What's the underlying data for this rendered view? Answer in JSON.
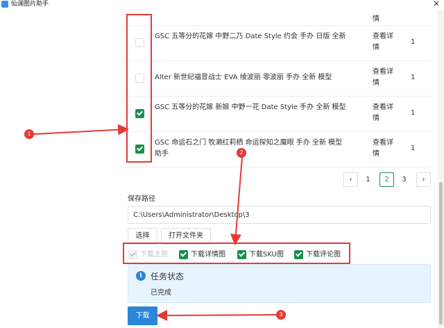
{
  "window": {
    "title": "仙澜图片助手",
    "minimize": "—",
    "maximize": "☐",
    "close": "✕"
  },
  "table": {
    "partial_top_detail": "情",
    "rows": [
      {
        "name": "GSC 五等分的花嫁 中野二乃 Date Style 约会 手办 日版 全新",
        "detail": "查看详情",
        "qty": "1",
        "checked": false
      },
      {
        "name": "Alter 新世纪福音战士 EVA 绫波丽 零波丽 手办 全新 模型",
        "detail": "查看详情",
        "qty": "1",
        "checked": false
      },
      {
        "name": "GSC 五等分的花嫁 新娘 中野一花 Date Style 手办 全新 模型",
        "detail": "查看详情",
        "qty": "1",
        "checked": true
      },
      {
        "name": "GSC 命运石之门 牧濑红莉栖 命运探知之魔眼 手办 全新 模型 助手",
        "detail": "查看详情",
        "qty": "1",
        "checked": true
      }
    ]
  },
  "pagination": {
    "prev": "‹",
    "pages": [
      "1",
      "2",
      "3"
    ],
    "active_page": "2",
    "next": "›"
  },
  "save": {
    "label": "保存路径",
    "path_value": "C:\\Users\\Administrator\\Desktop\\3",
    "choose_button": "选择",
    "open_folder_button": "打开文件夹"
  },
  "options": [
    {
      "label": "下载主图",
      "checked": true,
      "disabled": true
    },
    {
      "label": "下载详情图",
      "checked": true,
      "disabled": false
    },
    {
      "label": "下载SKU图",
      "checked": true,
      "disabled": false
    },
    {
      "label": "下载评论图",
      "checked": true,
      "disabled": false
    }
  ],
  "status": {
    "icon": "info-icon",
    "title": "任务状态",
    "text": "已完成"
  },
  "download_button": "下载",
  "annotations": {
    "badges": [
      "1",
      "2",
      "3"
    ],
    "color": "#e53935"
  },
  "colors": {
    "accent_green": "#1a8f4c",
    "accent_blue": "#2b86d8",
    "status_bg": "#e8f4fd"
  }
}
